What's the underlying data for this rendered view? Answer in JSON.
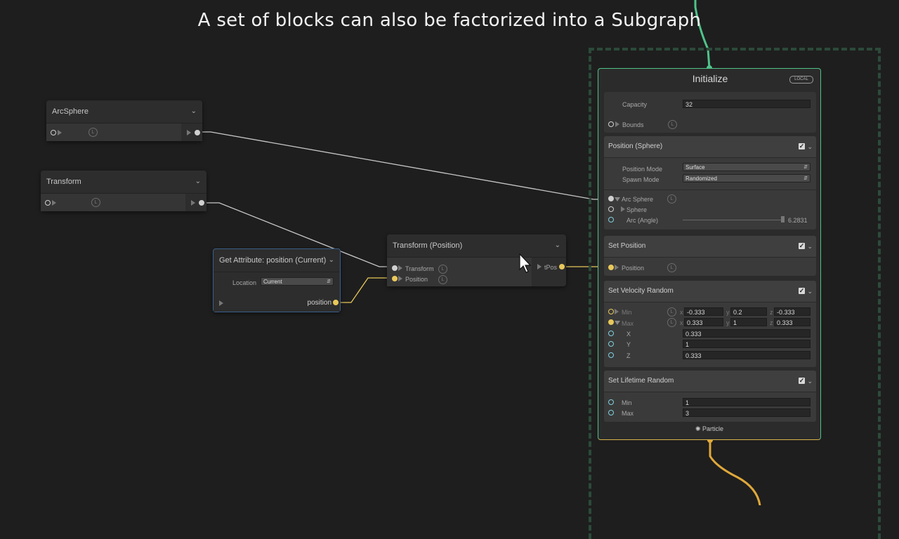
{
  "caption": "A set of blocks can also be factorized into a Subgraph",
  "colors": {
    "background": "#1e1e1e",
    "wire_white": "#c8c8c8",
    "wire_yellow": "#e8c85a",
    "wire_green": "#4fc38a",
    "wire_orange": "#e0a83a"
  },
  "arcsphere_node": {
    "title": "ArcSphere",
    "badge": "L"
  },
  "transform_node": {
    "title": "Transform",
    "badge": "L"
  },
  "get_attribute_node": {
    "title": "Get Attribute: position (Current)",
    "location_label": "Location",
    "location_value": "Current",
    "output_label": "position"
  },
  "transform_position_node": {
    "title": "Transform (Position)",
    "inputs": [
      "Transform",
      "Position"
    ],
    "badge": "L",
    "output_label": "tPos"
  },
  "context": {
    "title": "Initialize",
    "space_badge": "LOCAL",
    "capacity_label": "Capacity",
    "capacity_value": "32",
    "bounds_label": "Bounds",
    "footer_label": "Particle",
    "blocks": {
      "position_sphere": {
        "title": "Position (Sphere)",
        "position_mode_label": "Position Mode",
        "position_mode_value": "Surface",
        "spawn_mode_label": "Spawn Mode",
        "spawn_mode_value": "Randomized",
        "arc_sphere_label": "Arc Sphere",
        "sphere_label": "Sphere",
        "arc_angle_label": "Arc (Angle)",
        "arc_angle_value": "6.2831"
      },
      "set_position": {
        "title": "Set Position",
        "position_label": "Position"
      },
      "set_velocity_random": {
        "title": "Set Velocity Random",
        "min_label": "Min",
        "max_label": "Max",
        "x": "x",
        "y": "y",
        "z": "z",
        "min_x": "-0.333",
        "min_y": "0.2",
        "min_z": "-0.333",
        "max_x": "0.333",
        "max_y": "1",
        "max_z": "0.333",
        "X_label": "X",
        "Y_label": "Y",
        "Z_label": "Z",
        "X_value": "0.333",
        "Y_value": "1",
        "Z_value": "0.333"
      },
      "set_lifetime_random": {
        "title": "Set Lifetime Random",
        "min_label": "Min",
        "min_value": "1",
        "max_label": "Max",
        "max_value": "3"
      }
    }
  }
}
